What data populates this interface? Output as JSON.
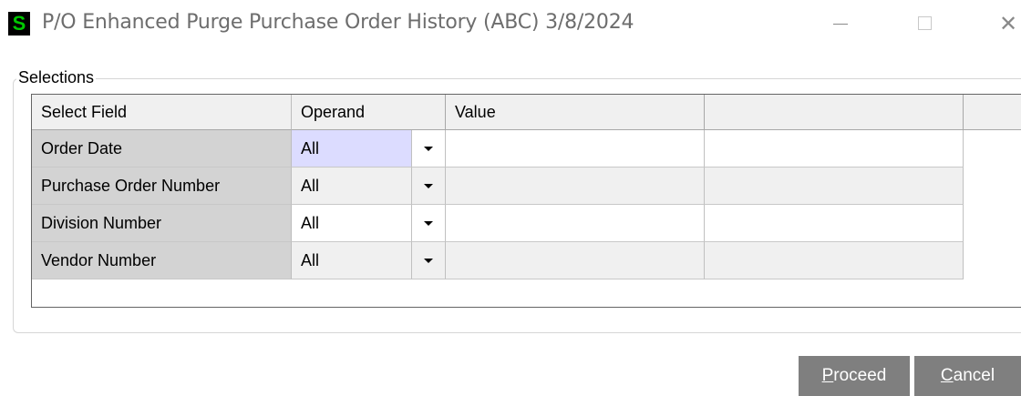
{
  "window": {
    "app_icon_letter": "S",
    "title": "P/O Enhanced Purge Purchase Order History (ABC) 3/8/2024",
    "minimize_icon": "minimize-icon",
    "maximize_icon": "maximize-icon",
    "close_icon": "close-icon",
    "close_glyph": "✕"
  },
  "selections": {
    "group_label": "Selections",
    "headers": {
      "field": "Select Field",
      "operand": "Operand",
      "value": "Value",
      "extra": ""
    },
    "rows": [
      {
        "field": "Order Date",
        "operand": "All",
        "value": "",
        "extra": ""
      },
      {
        "field": "Purchase Order Number",
        "operand": "All",
        "value": "",
        "extra": ""
      },
      {
        "field": "Division Number",
        "operand": "All",
        "value": "",
        "extra": ""
      },
      {
        "field": "Vendor Number",
        "operand": "All",
        "value": "",
        "extra": ""
      }
    ]
  },
  "buttons": {
    "proceed_mnemonic": "P",
    "proceed_rest": "roceed",
    "cancel_mnemonic": "C",
    "cancel_rest": "ancel"
  },
  "colors": {
    "button_bg": "#7f7f7f",
    "selected_operand_bg": "#dcdcff",
    "app_icon_fg": "#00c800"
  }
}
